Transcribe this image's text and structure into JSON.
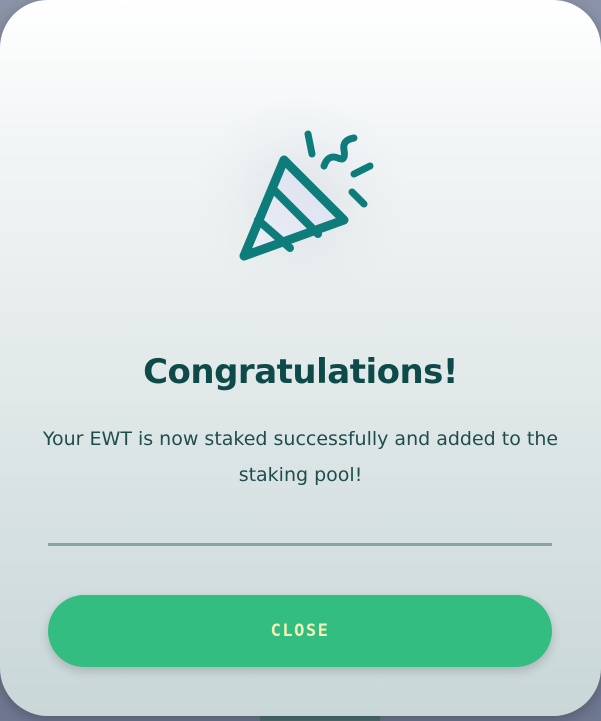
{
  "modal": {
    "icon": "party-popper-icon",
    "title": "Congratulations!",
    "message": "Your EWT is now staked successfully and added to the staking pool!",
    "close_label": "CLOSE"
  },
  "colors": {
    "title": "#0f4a4a",
    "text": "#1f4d4d",
    "accent_teal": "#0e7c7b",
    "button": "#34bd80",
    "button_text": "#f3f0b8",
    "divider": "#8aa4a6"
  }
}
